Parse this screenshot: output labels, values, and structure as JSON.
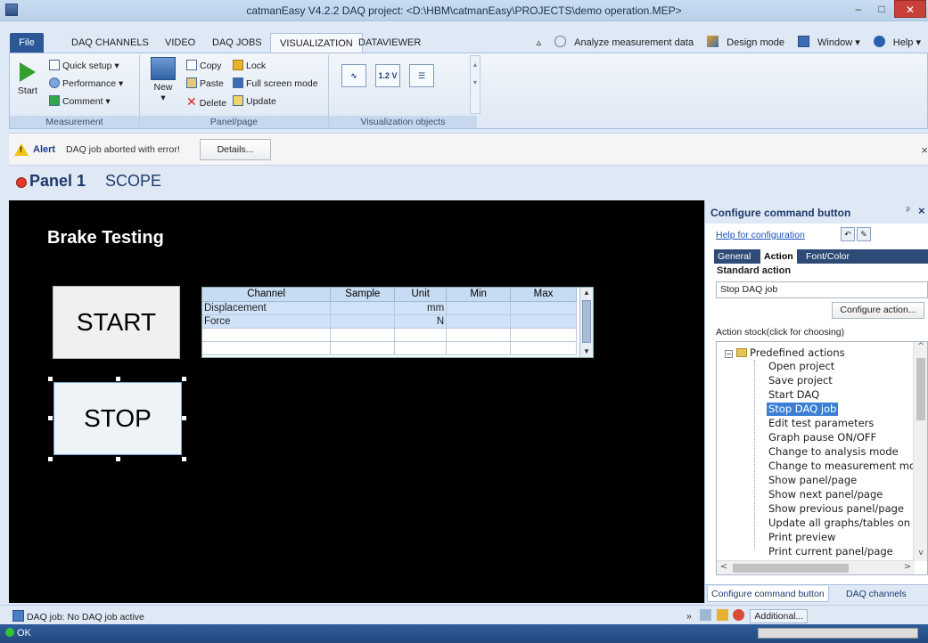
{
  "window": {
    "title": "catmanEasy V4.2.2 DAQ project: <D:\\HBM\\catmanEasy\\PROJECTS\\demo operation.MEP>",
    "minimize": "–",
    "maximize": "□",
    "close": "✕"
  },
  "ribbon_tabs": {
    "file": "File",
    "items": [
      "DAQ CHANNELS",
      "VIDEO",
      "DAQ JOBS",
      "VISUALIZATION",
      "DATAVIEWER"
    ],
    "active": "VISUALIZATION",
    "right": {
      "analyze": "Analyze measurement data",
      "design": "Design mode",
      "window": "Window",
      "help": "Help"
    }
  },
  "ribbon": {
    "measurement": {
      "label": "Measurement",
      "start": "Start",
      "quick_setup": "Quick setup",
      "performance": "Performance",
      "comment": "Comment"
    },
    "panel_page": {
      "label": "Panel/page",
      "new": "New",
      "copy": "Copy",
      "paste": "Paste",
      "delete": "Delete",
      "lock": "Lock",
      "full_screen": "Full screen mode",
      "update": "Update"
    },
    "vis_objects": {
      "label": "Visualization objects",
      "value_badge": "1.2 V"
    }
  },
  "alert": {
    "word": "Alert",
    "message": "DAQ job aborted with error!",
    "details": "Details...",
    "close": "×"
  },
  "panel": {
    "name": "Panel 1",
    "scope": "SCOPE"
  },
  "canvas": {
    "title": "Brake Testing",
    "start": "START",
    "stop": "STOP",
    "table": {
      "headers": [
        "Channel",
        "Sample",
        "Unit",
        "Min",
        "Max"
      ],
      "rows": [
        [
          "Displacement",
          "",
          "mm",
          "",
          ""
        ],
        [
          "Force",
          "",
          "N",
          "",
          ""
        ],
        [
          "",
          "",
          "",
          "",
          ""
        ],
        [
          "",
          "",
          "",
          "",
          ""
        ]
      ]
    }
  },
  "pane": {
    "title": "Configure command button",
    "help": "Help for configuration",
    "tabs": [
      "General",
      "Action",
      "Font/Color"
    ],
    "active_tab": "Action",
    "standard_action_label": "Standard action",
    "standard_action_value": "Stop DAQ job",
    "configure_action": "Configure action...",
    "stock_label": "Action stock(click for choosing)",
    "tree_root": "Predefined actions",
    "tree_items": [
      "Open project",
      "Save project",
      "Start DAQ",
      "Stop DAQ job",
      "Edit test parameters",
      "Graph pause ON/OFF",
      "Change to analysis mode",
      "Change to measurement mo",
      "Show panel/page",
      "Show next panel/page",
      "Show previous panel/page",
      "Update all graphs/tables on",
      "Print preview",
      "Print current panel/page"
    ],
    "selected_item": "Stop DAQ job",
    "bottom_tabs": [
      "Configure command button",
      "DAQ channels"
    ]
  },
  "status": {
    "daq": "DAQ job: No DAQ job active",
    "additional": "Additional...",
    "ok": "OK"
  },
  "colors": {
    "canvas_bg": "#000000",
    "selection": "#3a7fd5",
    "file_tab": "#2b5797",
    "alert_accent": "#f2c318"
  }
}
